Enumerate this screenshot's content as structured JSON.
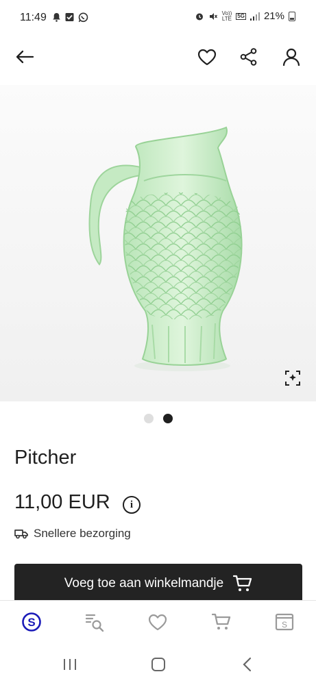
{
  "status_bar": {
    "time": "11:49",
    "network_label_top": "Vo))",
    "network_label_bottom": "LTE",
    "network_5g": "5G",
    "battery": "21%"
  },
  "product": {
    "title": "Pitcher",
    "price": "11,00 EUR",
    "delivery": "Snellere bezorging",
    "image_count": 2,
    "active_image": 2
  },
  "actions": {
    "add_to_cart_label": "Voeg toe aan winkelmandje"
  },
  "icons": {
    "header": [
      "arrow-left-icon",
      "heart-icon",
      "share-icon",
      "user-icon"
    ],
    "bottom_nav": [
      "s-logo-icon",
      "search-list-icon",
      "heart-icon",
      "cart-icon",
      "sell-icon"
    ],
    "system_nav": [
      "recent-apps-icon",
      "home-icon",
      "back-icon"
    ]
  },
  "colors": {
    "primary_dark": "#232323",
    "accent_blue": "#1a1ab8",
    "nav_inactive": "#9a9a9a"
  }
}
